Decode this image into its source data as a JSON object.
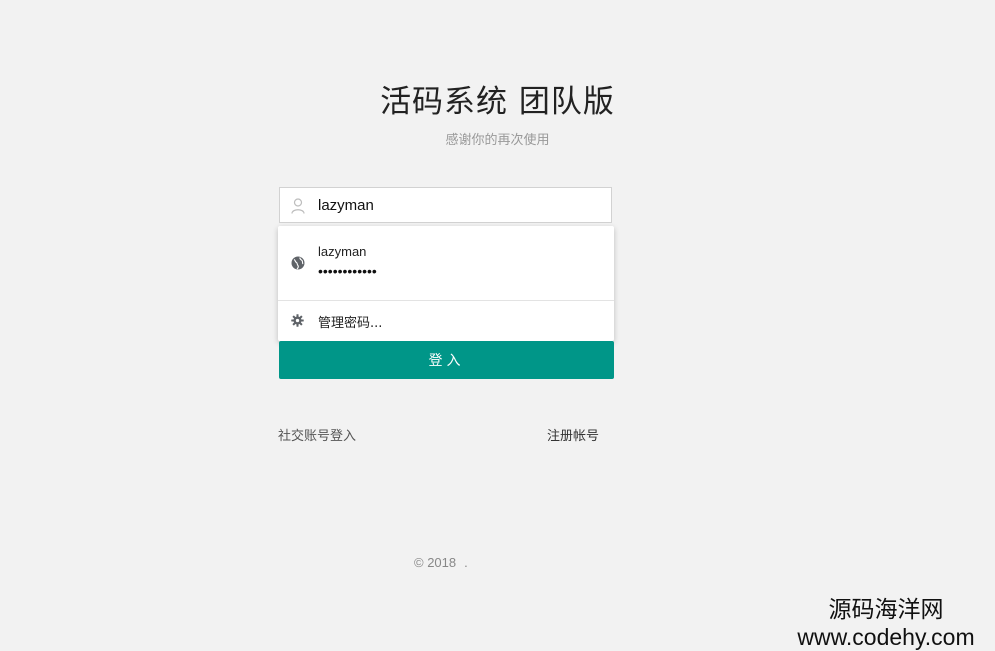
{
  "header": {
    "title": "活码系统 团队版",
    "subtitle": "感谢你的再次使用"
  },
  "form": {
    "username": {
      "value": "lazyman",
      "icon": "user-icon"
    },
    "autofill": {
      "saved_username": "lazyman",
      "saved_password_mask": "••••••••••••",
      "manage_label": "管理密码..."
    },
    "login_label": "登入",
    "social_login_label": "社交账号登入",
    "register_label": "注册帐号"
  },
  "footer": {
    "copyright": "© 2018",
    "dot": "."
  },
  "watermark": {
    "line1": "源码海洋网",
    "line2": "www.codehy.com"
  },
  "colors": {
    "accent": "#009688",
    "background": "#f2f2f2"
  }
}
